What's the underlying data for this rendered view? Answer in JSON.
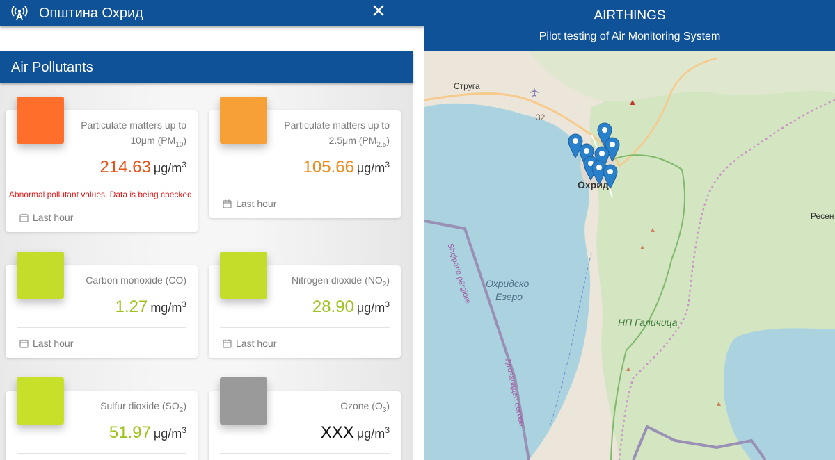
{
  "topbar": {
    "title": "Општина Охрид",
    "app_icon": "antenna-icon",
    "close_icon": "close-icon"
  },
  "section": {
    "title": "Air Pollutants"
  },
  "cards": [
    {
      "name": "Particulate matters up to 10μm (PM",
      "sub": "10",
      "name_tail": ")",
      "value": "214.63",
      "unit": "μg/m",
      "unit_sup": "3",
      "color": "#e8531a",
      "swatch": "#ff6f2b",
      "warning": "Abnormal pollutant values. Data is being checked.",
      "footer": "Last hour"
    },
    {
      "name": "Particulate matters up to 2.5μm (PM",
      "sub": "2.5",
      "name_tail": ")",
      "value": "105.66",
      "unit": "μg/m",
      "unit_sup": "3",
      "color": "#f08a1c",
      "swatch": "#f7a035",
      "warning": "",
      "footer": "Last hour"
    },
    {
      "name": "Carbon monoxide (CO)",
      "sub": "",
      "name_tail": "",
      "value": "1.27",
      "unit": "mg/m",
      "unit_sup": "3",
      "color": "#9cc31a",
      "swatch": "#c3dd2a",
      "warning": "",
      "footer": "Last hour"
    },
    {
      "name": "Nitrogen dioxide (NO",
      "sub": "2",
      "name_tail": ")",
      "value": "28.90",
      "unit": "μg/m",
      "unit_sup": "3",
      "color": "#9cc31a",
      "swatch": "#c3dd2a",
      "warning": "",
      "footer": "Last hour"
    },
    {
      "name": "Sulfur dioxide (SO",
      "sub": "2",
      "name_tail": ")",
      "value": "51.97",
      "unit": "μg/m",
      "unit_sup": "3",
      "color": "#9cc31a",
      "swatch": "#c8e02a",
      "warning": "",
      "footer": ""
    },
    {
      "name": "Ozone (O",
      "sub": "3",
      "name_tail": ")",
      "value": "XXX",
      "unit": "μg/m",
      "unit_sup": "3",
      "color": "#111111",
      "swatch": "#9a9a9a",
      "warning": "",
      "footer": ""
    }
  ],
  "map_header": {
    "title": "AIRTHINGS",
    "subtitle": "Pilot testing of Air Monitoring System"
  },
  "map": {
    "labels": {
      "struga": "Струга",
      "ohrid": "Охрид",
      "lake": "Охридско",
      "lake2": "Езеро",
      "park": "НП Галичица",
      "resen": "Ресен",
      "road": "32",
      "border_al": "Shqipëria përgjore",
      "border_mk": "Југозападен регион"
    },
    "marker_icon": "map-pin-icon",
    "airport_icon": "airport-icon"
  }
}
